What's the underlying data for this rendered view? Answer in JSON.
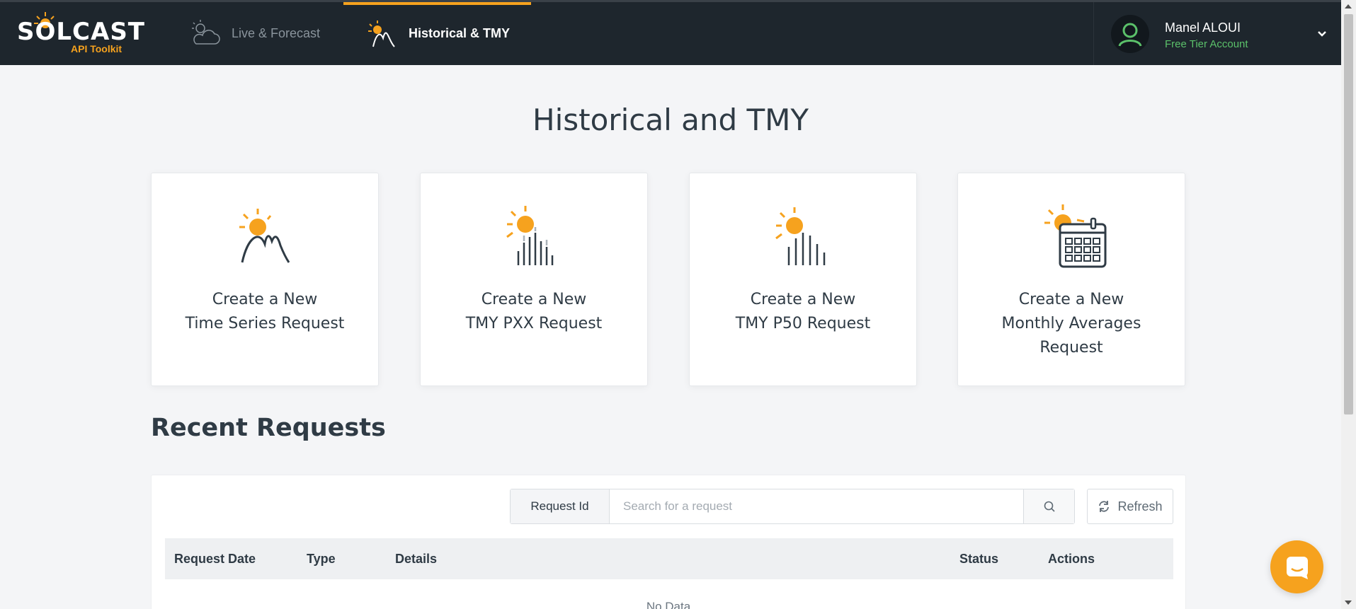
{
  "brand": {
    "name": "SOLCAST",
    "subtitle": "API Toolkit"
  },
  "nav": {
    "tabs": [
      {
        "label": "Live & Forecast",
        "icon": "cloud-sun-icon",
        "active": false
      },
      {
        "label": "Historical & TMY",
        "icon": "sun-mountain-icon",
        "active": true
      }
    ]
  },
  "user": {
    "name": "Manel ALOUI",
    "tier": "Free Tier Account"
  },
  "page": {
    "title": "Historical and TMY"
  },
  "cards": [
    {
      "label": "Create a New\nTime Series Request",
      "icon": "time-series-icon"
    },
    {
      "label": "Create a New\nTMY PXX Request",
      "icon": "tmy-pxx-icon"
    },
    {
      "label": "Create a New\nTMY P50 Request",
      "icon": "tmy-p50-icon"
    },
    {
      "label": "Create a New\nMonthly Averages\nRequest",
      "icon": "calendar-icon"
    }
  ],
  "recent": {
    "title": "Recent Requests",
    "search_addon": "Request Id",
    "search_placeholder": "Search for a request",
    "refresh_label": "Refresh",
    "columns": [
      "Request Date",
      "Type",
      "Details",
      "Status",
      "Actions"
    ],
    "empty_text": "No Data"
  },
  "colors": {
    "accent": "#f6a21e",
    "nav_bg": "#1e262d",
    "tier_green": "#5bc16a"
  }
}
